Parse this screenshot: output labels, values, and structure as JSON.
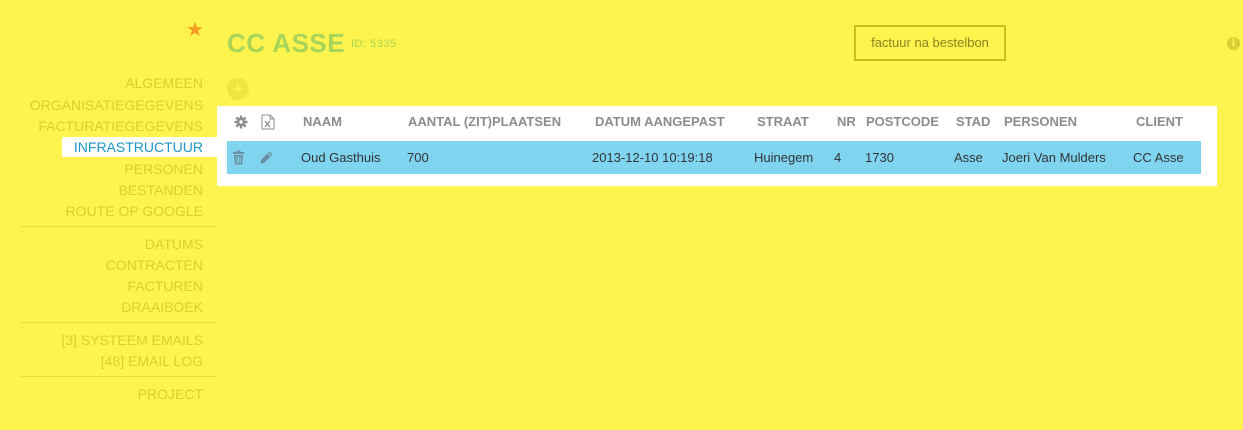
{
  "sidebar": {
    "items": [
      {
        "label": "ALGEMEEN"
      },
      {
        "label": "ORGANISATIEGEGEVENS"
      },
      {
        "label": "FACTURATIEGEGEVENS"
      },
      {
        "label": "INFRASTRUCTUUR",
        "active": true
      },
      {
        "label": "PERSONEN"
      },
      {
        "label": "BESTANDEN"
      },
      {
        "label": "ROUTE OP GOOGLE"
      },
      {
        "label": "DATUMS"
      },
      {
        "label": "CONTRACTEN"
      },
      {
        "label": "FACTUREN"
      },
      {
        "label": "DRAAIBOEK"
      },
      {
        "label": "[3] SYSTEEM EMAILS"
      },
      {
        "label": "[48] EMAIL LOG"
      },
      {
        "label": "PROJECT"
      }
    ]
  },
  "header": {
    "title": "CC ASSE",
    "id_label": "ID: 5335",
    "factuur_button": "factuur na bestelbon"
  },
  "table": {
    "columns": [
      "NAAM",
      "AANTAL (ZIT)PLAATSEN",
      "DATUM AANGEPAST",
      "STRAAT",
      "NR",
      "POSTCODE",
      "STAD",
      "PERSONEN",
      "CLIENT"
    ],
    "rows": [
      {
        "naam": "Oud Gasthuis",
        "plaatsen": "700",
        "datum": "2013-12-10 10:19:18",
        "straat": "Huinegem",
        "nr": "4",
        "postcode": "1730",
        "stad": "Asse",
        "personen": "Joeri Van Mulders",
        "client": "CC Asse"
      }
    ]
  },
  "colors": {
    "background": "#fff34d",
    "active_text": "#1e96c8",
    "row_highlight": "#7fd4f0",
    "title": "#a8d45a",
    "star": "#f59a23"
  },
  "icons": {
    "star": "star-icon",
    "info": "info-icon",
    "add": "add-icon",
    "settings": "gear-icon",
    "excel": "excel-export-icon",
    "delete": "trash-icon",
    "edit": "pencil-icon"
  }
}
